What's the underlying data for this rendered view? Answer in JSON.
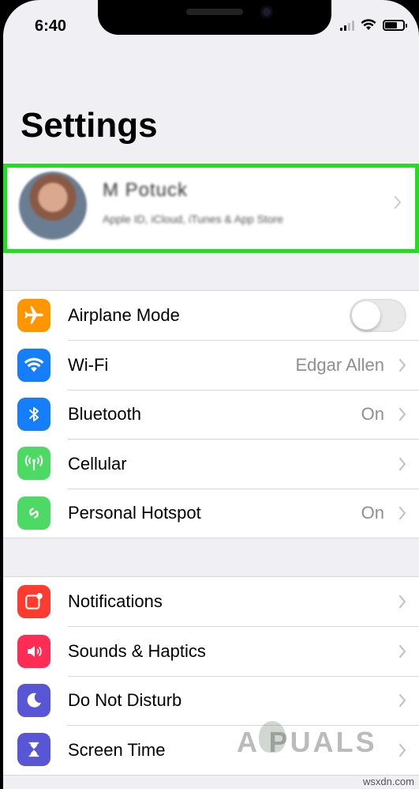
{
  "status_bar": {
    "time": "6:40"
  },
  "page_title": "Settings",
  "profile": {
    "name": "M Potuck",
    "subtitle": "Apple ID, iCloud, iTunes & App Store"
  },
  "group1": [
    {
      "label": "Airplane Mode",
      "icon": "airplane-icon",
      "color": "#ff9500",
      "toggle": false
    },
    {
      "label": "Wi-Fi",
      "icon": "wifi-icon",
      "color": "#147efb",
      "value": "Edgar Allen"
    },
    {
      "label": "Bluetooth",
      "icon": "bluetooth-icon",
      "color": "#147efb",
      "value": "On"
    },
    {
      "label": "Cellular",
      "icon": "cellular-icon",
      "color": "#4cd964",
      "value": ""
    },
    {
      "label": "Personal Hotspot",
      "icon": "hotspot-icon",
      "color": "#4cd964",
      "value": "On"
    }
  ],
  "group2": [
    {
      "label": "Notifications",
      "icon": "notifications-icon",
      "color": "#ff3b30"
    },
    {
      "label": "Sounds & Haptics",
      "icon": "speaker-icon",
      "color": "#ff2d55"
    },
    {
      "label": "Do Not Disturb",
      "icon": "moon-icon",
      "color": "#5856d6"
    },
    {
      "label": "Screen Time",
      "icon": "hourglass-icon",
      "color": "#5856d6"
    }
  ],
  "watermark": {
    "brand": "A PUALS",
    "url": "wsxdn.com"
  }
}
